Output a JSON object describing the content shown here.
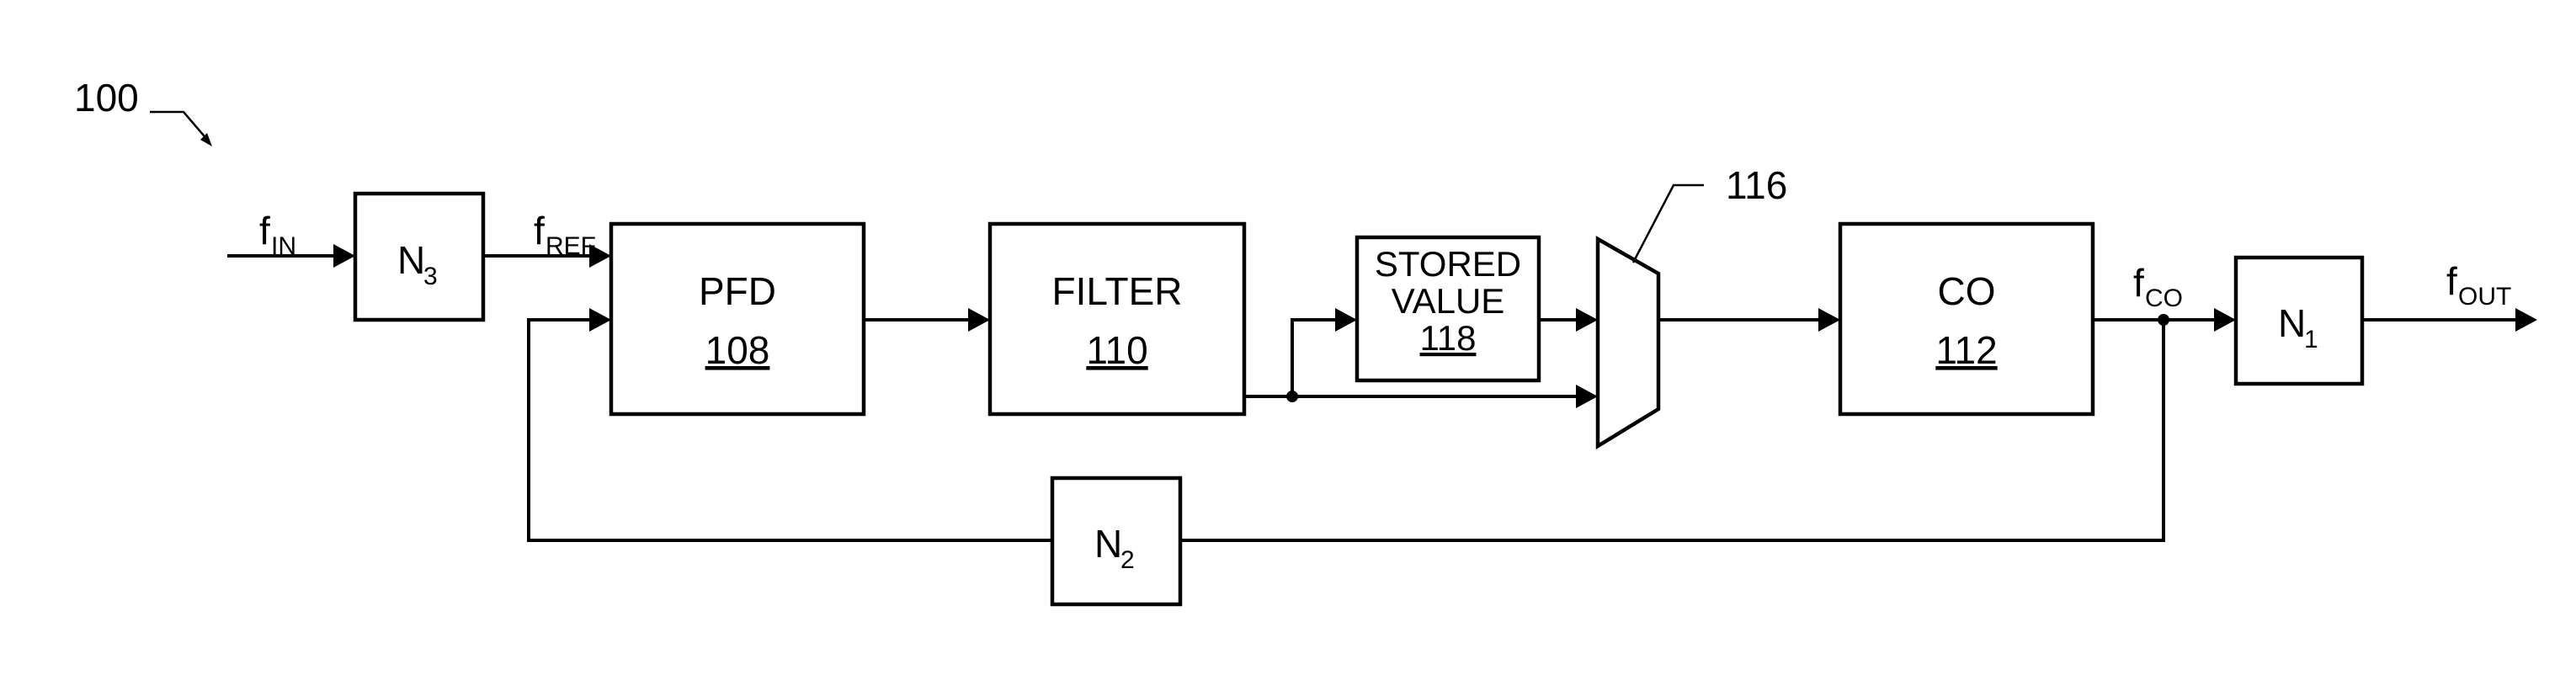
{
  "figure": {
    "reference": "100",
    "mux_reference": "116"
  },
  "signals": {
    "f_in": {
      "base": "f",
      "sub": "IN"
    },
    "f_ref": {
      "base": "f",
      "sub": "REF"
    },
    "f_co": {
      "base": "f",
      "sub": "CO"
    },
    "f_out": {
      "base": "f",
      "sub": "OUT"
    }
  },
  "blocks": {
    "n3": {
      "base": "N",
      "sub": "3"
    },
    "pfd": {
      "label": "PFD",
      "ref": "108"
    },
    "filter": {
      "label": "FILTER",
      "ref": "110"
    },
    "stored": {
      "line1": "STORED",
      "line2": "VALUE",
      "ref": "118"
    },
    "co": {
      "label": "CO",
      "ref": "112"
    },
    "n1": {
      "base": "N",
      "sub": "1"
    },
    "n2": {
      "base": "N",
      "sub": "2"
    }
  }
}
